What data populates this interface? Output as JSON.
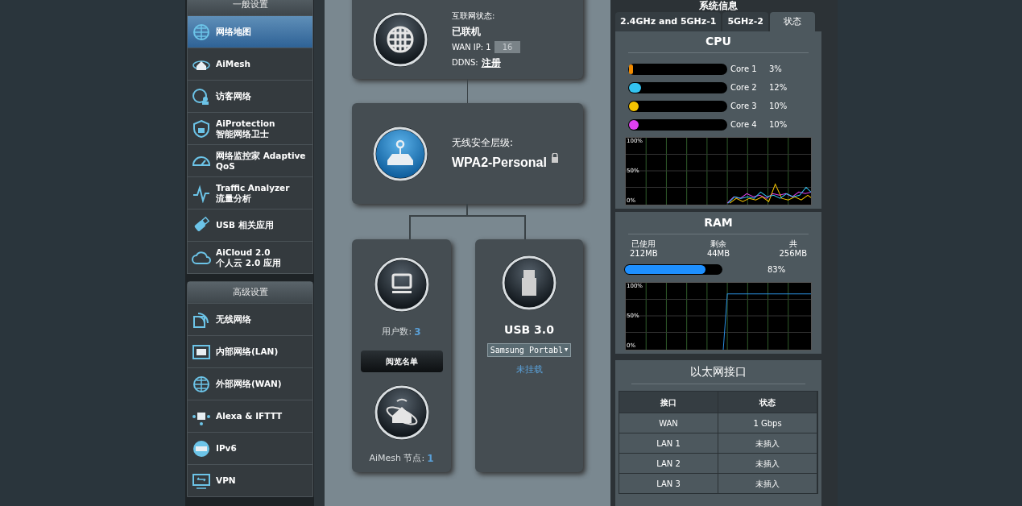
{
  "sidebar": {
    "groups": [
      {
        "title": "一般设置",
        "items": [
          {
            "lines": [
              "网络地图"
            ],
            "selected": true
          },
          {
            "lines": [
              "AiMesh"
            ],
            "selected": false
          },
          {
            "lines": [
              "访客网络"
            ],
            "selected": false
          },
          {
            "lines": [
              "AiProtection",
              "智能网络卫士"
            ],
            "selected": false
          },
          {
            "lines": [
              "网络监控家 Adaptive",
              "QoS"
            ],
            "selected": false
          },
          {
            "lines": [
              "Traffic Analyzer",
              "流量分析"
            ],
            "selected": false
          },
          {
            "lines": [
              "USB 相关应用"
            ],
            "selected": false
          },
          {
            "lines": [
              "AiCloud 2.0",
              "个人云 2.0 应用"
            ],
            "selected": false
          }
        ]
      },
      {
        "title": "高级设置",
        "items": [
          {
            "lines": [
              "无线网络"
            ],
            "selected": false
          },
          {
            "lines": [
              "内部网络(LAN)"
            ],
            "selected": false
          },
          {
            "lines": [
              "外部网络(WAN)"
            ],
            "selected": false
          },
          {
            "lines": [
              "Alexa & IFTTT"
            ],
            "selected": false
          },
          {
            "lines": [
              "IPv6"
            ],
            "selected": false
          },
          {
            "lines": [
              "VPN"
            ],
            "selected": false
          }
        ]
      }
    ]
  },
  "internet": {
    "status_label": "互联网状态:",
    "status": "已联机",
    "wan_ip_label": "WAN IP: 1",
    "wan_ip_blurred": "16",
    "ddns_label": "DDNS:",
    "ddns_link": "注册"
  },
  "wireless": {
    "label": "无线安全层级:",
    "value": "WPA2-Personal"
  },
  "clients": {
    "label": "用户数:",
    "count": "3",
    "button": "阅览名单",
    "aimesh_label": "AiMesh 节点:",
    "aimesh_count": "1"
  },
  "usb": {
    "title": "USB 3.0",
    "device": "Samsung Portabl",
    "caret": "▼",
    "status": "未挂载"
  },
  "system_info": {
    "title": "系统信息",
    "tabs": [
      {
        "label": "2.4GHz and 5GHz-1",
        "selected": false
      },
      {
        "label": "5GHz-2",
        "selected": false
      },
      {
        "label": "状态",
        "selected": true
      }
    ],
    "cpu": {
      "title": "CPU",
      "cores": [
        {
          "name": "Core 1",
          "reading": "3%",
          "level": 0.03,
          "color": "#f08a00"
        },
        {
          "name": "Core 2",
          "reading": "12%",
          "level": 0.12,
          "color": "#33c3f0"
        },
        {
          "name": "Core 3",
          "reading": "10%",
          "level": 0.1,
          "color": "#f5c400"
        },
        {
          "name": "Core 4",
          "reading": "10%",
          "level": 0.1,
          "color": "#e040f0"
        }
      ],
      "graph_labels": [
        "100%",
        "50%",
        "0%"
      ]
    },
    "ram": {
      "title": "RAM",
      "stats": [
        {
          "label": "已使用",
          "value": "212MB"
        },
        {
          "label": "剩余",
          "value": "44MB"
        },
        {
          "label": "共",
          "value": "256MB"
        }
      ],
      "level": 0.83,
      "reading": "83%",
      "graph_labels": [
        "100%",
        "50%",
        "0%"
      ]
    },
    "ethernet": {
      "title": "以太网接口",
      "columns": [
        "接口",
        "状态"
      ],
      "rows": [
        [
          "WAN",
          "1 Gbps"
        ],
        [
          "LAN 1",
          "未插入"
        ],
        [
          "LAN 2",
          "未插入"
        ],
        [
          "LAN 3",
          "未插入"
        ]
      ]
    }
  }
}
